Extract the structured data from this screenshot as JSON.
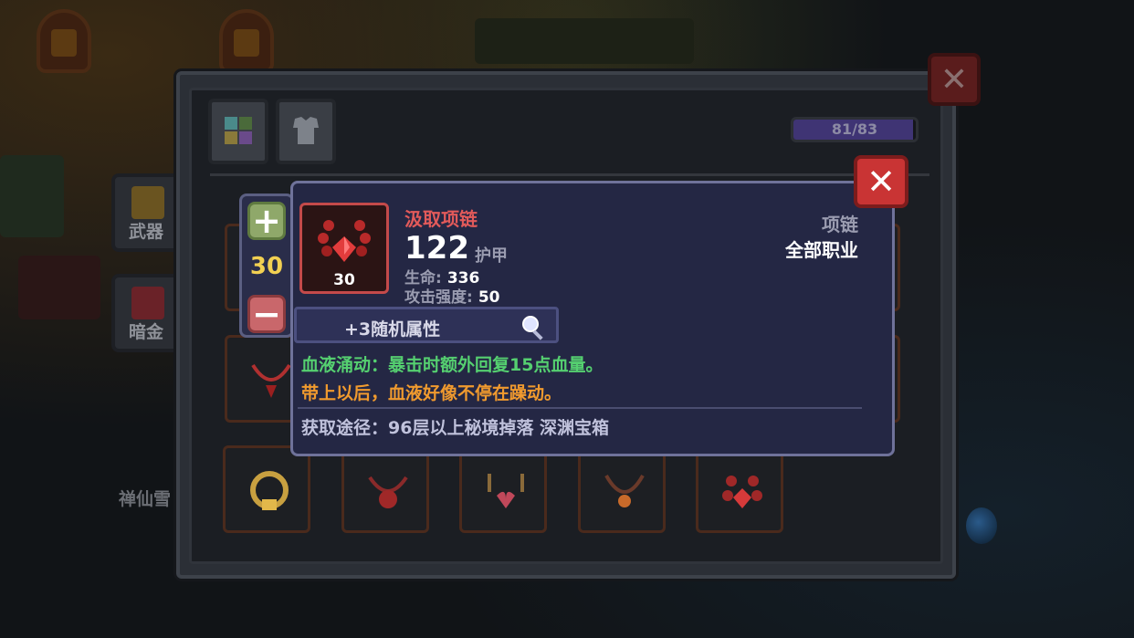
{
  "background": {
    "weapon_tab_label": "武器",
    "darkgold_tab_label": "暗金",
    "npc_name_partial": "禅仙雪"
  },
  "panel": {
    "capacity_text": "81/83",
    "capacity_fraction": 0.976,
    "close_icon": "close-icon"
  },
  "tooltip": {
    "quantity": "30",
    "plus_label": "+",
    "minus_label": "−",
    "close_label": "✕",
    "item": {
      "name": "汲取项链",
      "level": "30",
      "armor_value": "122",
      "armor_label": "护甲",
      "type": "项链",
      "class": "全部职业",
      "stats": [
        {
          "key": "生命:",
          "value": "336"
        },
        {
          "key": "攻击强度:",
          "value": "50"
        }
      ]
    },
    "random_attr_label": "+3随机属性",
    "effect_text": "血液涌动：暴击时额外回复15点血量。",
    "flavor_text": "带上以后，血液好像不停在躁动。",
    "source_text": "获取途径：96层以上秘境掉落 深渊宝箱"
  },
  "colors": {
    "item_name": "#e25a5a",
    "effect": "#55d070",
    "flavor": "#f09a2e",
    "quantity": "#f2d052",
    "close_button": "#c93434"
  }
}
